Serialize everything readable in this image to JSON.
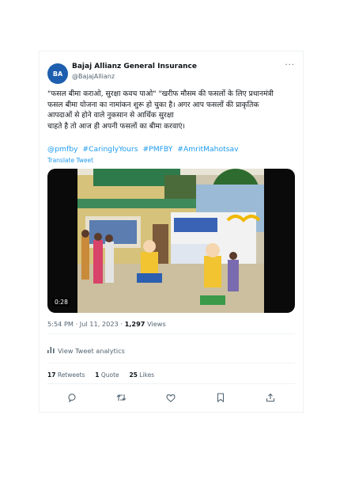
{
  "account": {
    "name": "Bajaj Allianz General Insurance",
    "handle": "@BajajAllianz",
    "avatar_text": "BA",
    "more_label": "···"
  },
  "tweet": {
    "lines": [
      "\"फसल बीमा कराओ, सुरक्षा कवच पाओ\" \"खरीफ मौसम की फसलों के लिए प्रधानमंत्री",
      "फसल बीमा योजना का नामांकन शुरू हो चुका है। अगर आप फसलों की प्राकृतिक",
      "आपदाओं से होने वाले नुकसान से आर्थिक सुरक्षा",
      "चाहते है तो आज ही अपनी फसलों का बीमा करवाएं।"
    ],
    "hashtags": [
      "@pmfby",
      "#CaringlyYours",
      "#PMFBY",
      "#AmritMahotsav"
    ],
    "translate_label": "Translate Tweet"
  },
  "video": {
    "duration": "0:28"
  },
  "meta": {
    "time": "5:54 PM · Jul 11, 2023",
    "separator": " · ",
    "views_count": "1,297",
    "views_label": " Views"
  },
  "analytics": {
    "label": "View Tweet analytics"
  },
  "stats": {
    "retweets_count": "17",
    "retweets_label": " Retweets",
    "quotes_count": "1",
    "quotes_label": " Quote",
    "likes_count": "25",
    "likes_label": " Likes"
  },
  "colors": {
    "link": "#1d9bf0",
    "brand": "#1d5fae",
    "muted": "#536471"
  }
}
